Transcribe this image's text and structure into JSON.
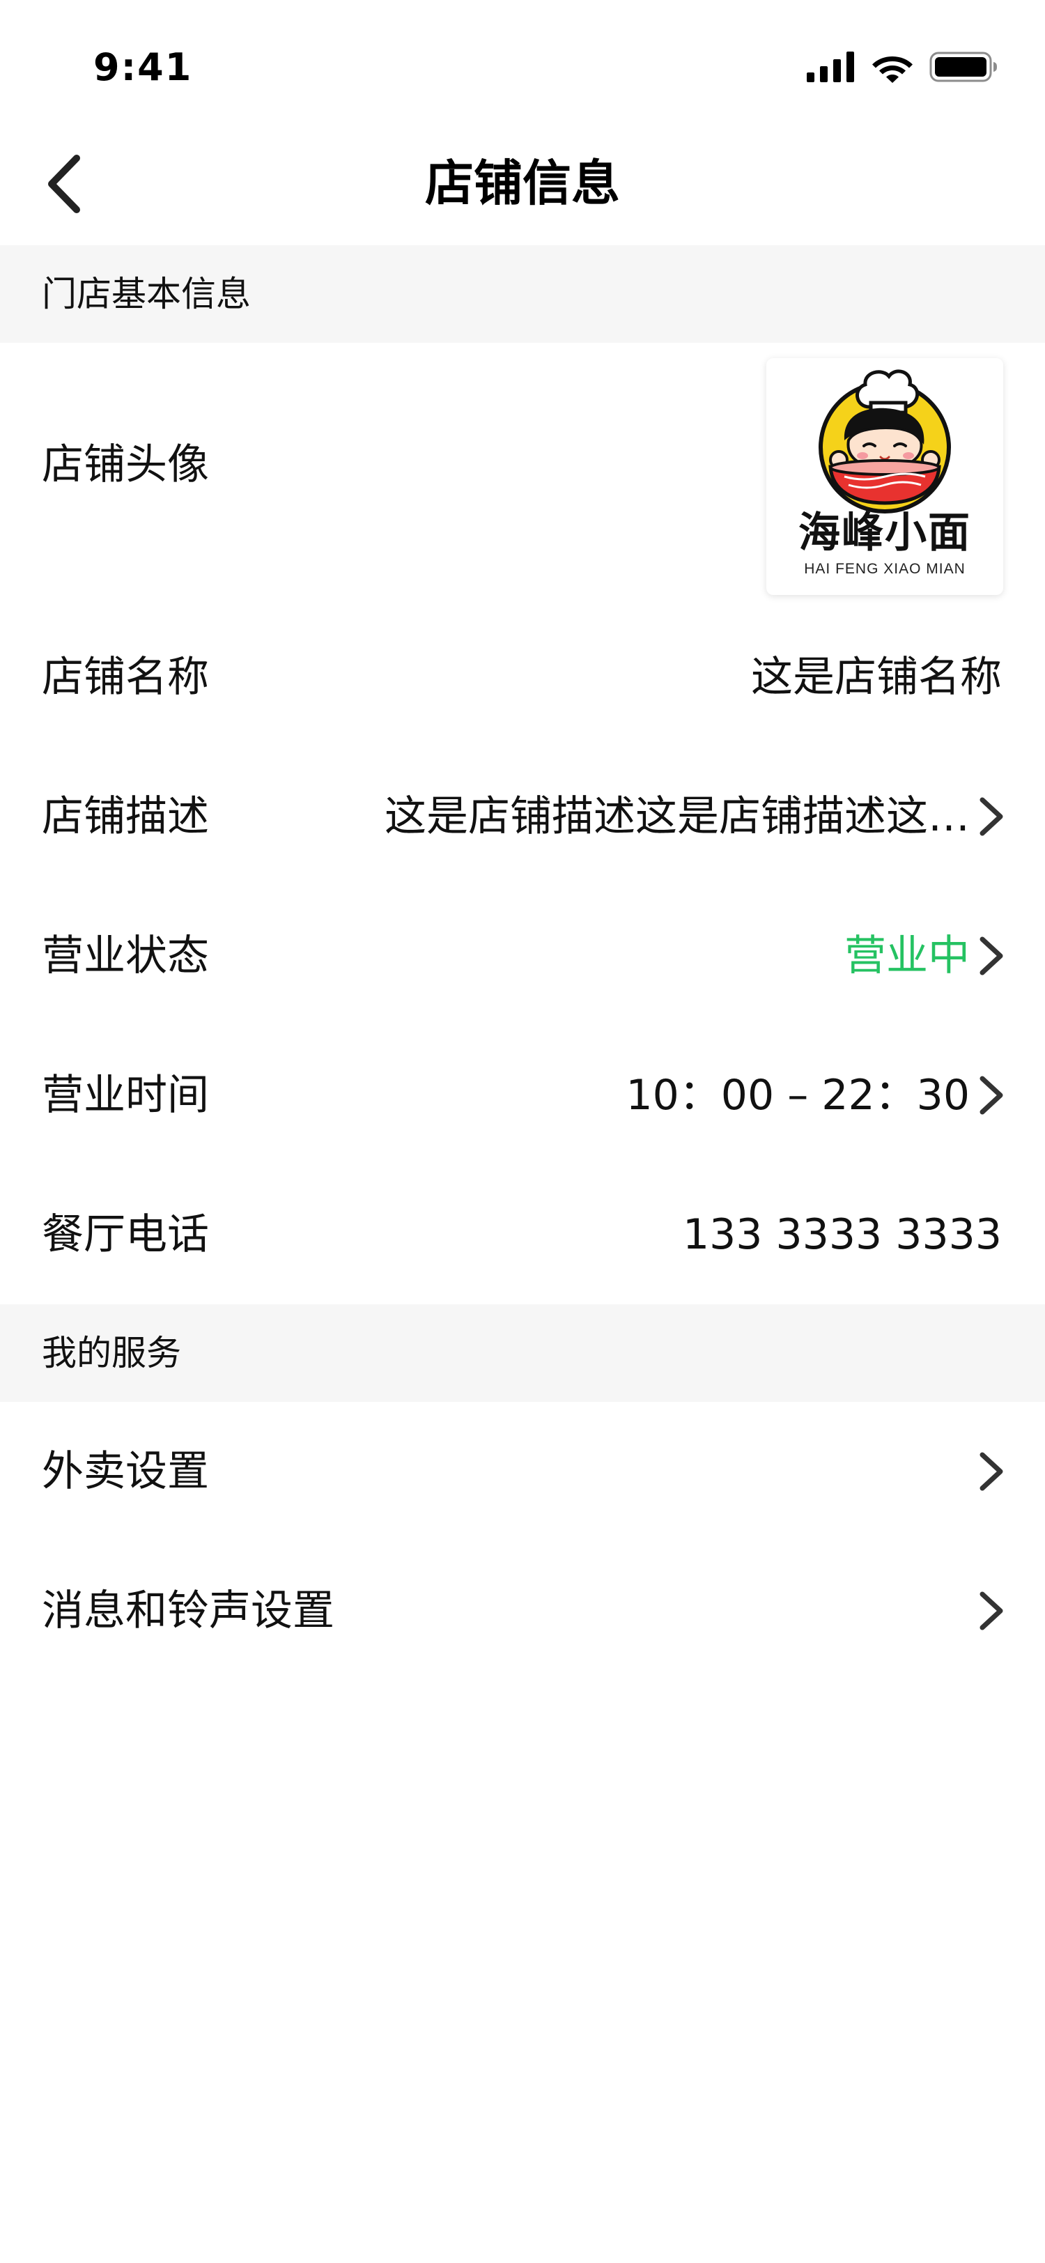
{
  "status_bar": {
    "time": "9:41",
    "icons": [
      "cellular-signal-icon",
      "wifi-icon",
      "battery-icon"
    ]
  },
  "nav": {
    "back_icon": "chevron-left-icon",
    "title": "店铺信息"
  },
  "section_basic": {
    "title": "门店基本信息",
    "rows": {
      "avatar": {
        "label": "店铺头像",
        "logo_title": "海峰小面",
        "logo_subtitle": "HAI FENG XIAO MIAN"
      },
      "name": {
        "label": "店铺名称",
        "value": "这是店铺名称"
      },
      "description": {
        "label": "店铺描述",
        "value": "这是店铺描述这是店铺描述这…"
      },
      "status": {
        "label": "营业状态",
        "value": "营业中",
        "value_color": "#25c262"
      },
      "hours": {
        "label": "营业时间",
        "value": "10：00 – 22：30"
      },
      "phone": {
        "label": "餐厅电话",
        "value": "133 3333 3333"
      }
    }
  },
  "section_services": {
    "title": "我的服务",
    "rows": {
      "delivery": {
        "label": "外卖设置"
      },
      "notifications": {
        "label": "消息和铃声设置"
      }
    }
  },
  "colors": {
    "accent_green": "#25c262",
    "section_background": "#f6f6f6",
    "chevron": "#333333"
  }
}
